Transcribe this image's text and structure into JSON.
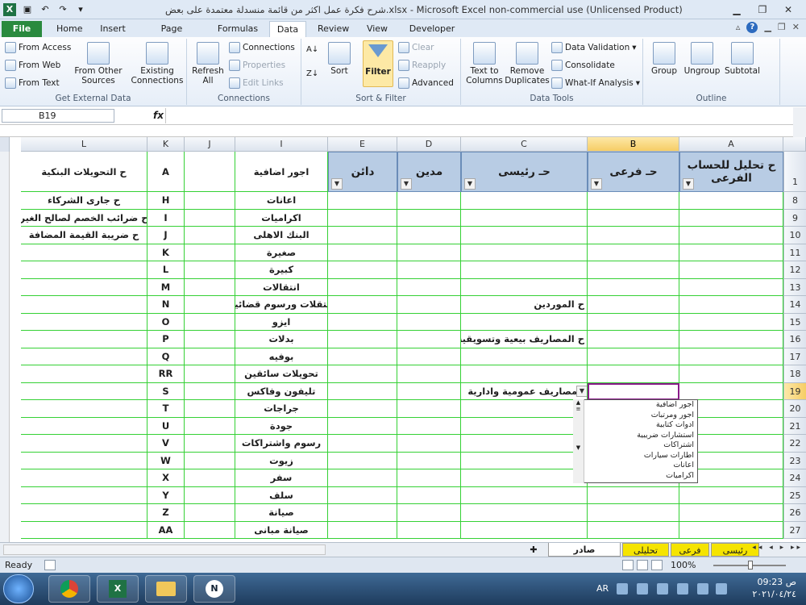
{
  "window": {
    "title": "شرح فكرة عمل اكثر من قائمة منسدلة معتمدة على بعض.xlsx - Microsoft Excel non-commercial use (Unlicensed Product)"
  },
  "ribbon": {
    "tabs": [
      "File",
      "Home",
      "Insert",
      "Page Layout",
      "Formulas",
      "Data",
      "Review",
      "View",
      "Developer"
    ],
    "active_tab": "Data",
    "get_external": {
      "from_access": "From Access",
      "from_web": "From Web",
      "from_text": "From Text",
      "from_other": "From Other Sources",
      "existing": "Existing Connections",
      "label": "Get External Data"
    },
    "connections": {
      "refresh": "Refresh All",
      "connections": "Connections",
      "properties": "Properties",
      "edit_links": "Edit Links",
      "label": "Connections"
    },
    "sort_filter": {
      "sort": "Sort",
      "filter": "Filter",
      "clear": "Clear",
      "reapply": "Reapply",
      "advanced": "Advanced",
      "label": "Sort & Filter"
    },
    "data_tools": {
      "text_to_columns": "Text to Columns",
      "remove_duplicates": "Remove Duplicates",
      "data_validation": "Data Validation",
      "consolidate": "Consolidate",
      "what_if": "What-If Analysis",
      "label": "Data Tools"
    },
    "outline": {
      "group": "Group",
      "ungroup": "Ungroup",
      "subtotal": "Subtotal",
      "label": "Outline"
    }
  },
  "formula_bar": {
    "name_box": "B19",
    "fx": "fx",
    "value": ""
  },
  "columns": [
    "A",
    "B",
    "C",
    "D",
    "E",
    "I",
    "J",
    "K",
    "L"
  ],
  "header_row": {
    "row_num": "1",
    "A": "ح تحليل للحساب الفرعى",
    "B": "حـ فرعى",
    "C": "حـ رئيسى",
    "D": "مدين",
    "E": "دائن",
    "I": "اجور اضافية",
    "K": "A",
    "L": "ح التحويلات البنكية"
  },
  "rows": [
    {
      "num": "8",
      "C": "",
      "I": "اعانات",
      "K": "H",
      "L": "ح جارى الشركاء"
    },
    {
      "num": "9",
      "C": "",
      "I": "اكراميات",
      "K": "I",
      "L": "ح ضرائب الخصم لصالح الغير"
    },
    {
      "num": "10",
      "C": "",
      "I": "البنك الاهلى",
      "K": "J",
      "L": "ح ضريبة القيمة المضافة"
    },
    {
      "num": "11",
      "C": "",
      "I": "صغيرة",
      "K": "K",
      "L": ""
    },
    {
      "num": "12",
      "C": "",
      "I": "كبيرة",
      "K": "L",
      "L": ""
    },
    {
      "num": "13",
      "C": "",
      "I": "انتقالات",
      "K": "M",
      "L": ""
    },
    {
      "num": "14",
      "C": "ح الموردين",
      "I": "انتقلات ورسوم قضائية",
      "K": "N",
      "L": ""
    },
    {
      "num": "15",
      "C": "",
      "I": "ايزو",
      "K": "O",
      "L": ""
    },
    {
      "num": "16",
      "C": "ح المصاريف بيعية وتسويقية",
      "I": "بدلات",
      "K": "P",
      "L": ""
    },
    {
      "num": "17",
      "C": "",
      "I": "بوفيه",
      "K": "Q",
      "L": ""
    },
    {
      "num": "18",
      "C": "",
      "I": "تحويلات سائقين",
      "K": "RR",
      "L": ""
    },
    {
      "num": "19",
      "C": "المصاريف عمومية وادارية",
      "I": "تليفون وفاكس",
      "K": "S",
      "L": ""
    },
    {
      "num": "20",
      "C": "",
      "I": "جراجات",
      "K": "T",
      "L": ""
    },
    {
      "num": "21",
      "C": "",
      "I": "جودة",
      "K": "U",
      "L": ""
    },
    {
      "num": "22",
      "C": "",
      "I": "رسوم واشتراكات",
      "K": "V",
      "L": ""
    },
    {
      "num": "23",
      "C": "",
      "I": "زيوت",
      "K": "W",
      "L": ""
    },
    {
      "num": "24",
      "C": "",
      "I": "سفر",
      "K": "X",
      "L": ""
    },
    {
      "num": "25",
      "C": "",
      "I": "سلف",
      "K": "Y",
      "L": ""
    },
    {
      "num": "26",
      "C": "",
      "I": "صيانة",
      "K": "Z",
      "L": ""
    },
    {
      "num": "27",
      "C": "",
      "I": "صيانة مبانى",
      "K": "AA",
      "L": ""
    }
  ],
  "dropdown_list": [
    "اجور اضافية",
    "اجور ومرتبات",
    "ادوات كتابية",
    "استشارات ضريبية",
    "اشتراكات",
    "اطارات سيارات",
    "اعانات",
    "اكراميات"
  ],
  "sheet_tabs": [
    "رئيسى",
    "فرعى",
    "تحليلى",
    "صادر الصندوق"
  ],
  "active_sheet": "صادر الصندوق",
  "status": {
    "ready": "Ready",
    "zoom": "100%"
  },
  "taskbar": {
    "lang": "AR",
    "time": "09:23 ص",
    "date": "٢٠٢١/٠٤/٢٤"
  }
}
